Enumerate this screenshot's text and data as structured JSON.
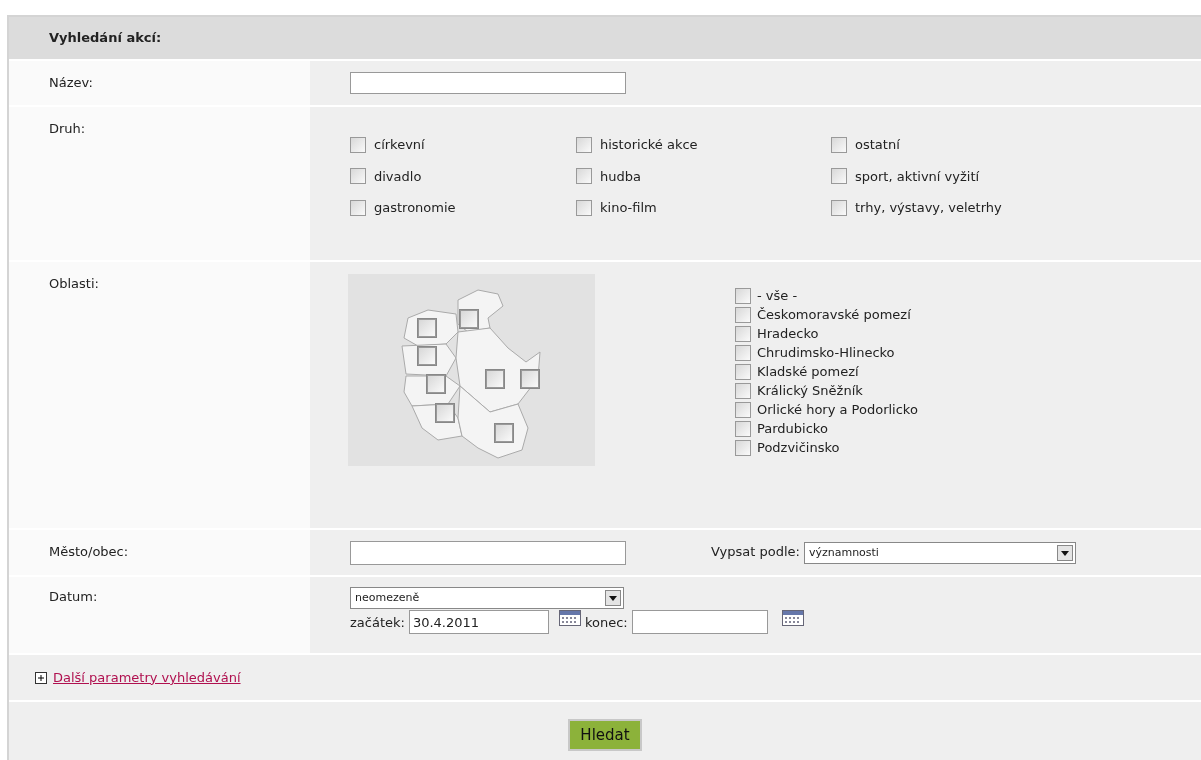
{
  "header": "Vyhledání akcí:",
  "name_field": {
    "label": "Název:"
  },
  "types": {
    "label": "Druh:",
    "options": [
      {
        "label": "církevní",
        "checked": false
      },
      {
        "label": "historické akce",
        "checked": false
      },
      {
        "label": "ostatní",
        "checked": false
      },
      {
        "label": "divadlo",
        "checked": false
      },
      {
        "label": "hudba",
        "checked": false
      },
      {
        "label": "sport, aktivní vyžití",
        "checked": false
      },
      {
        "label": "gastronomie",
        "checked": false
      },
      {
        "label": "kino-film",
        "checked": false
      },
      {
        "label": "trhy, výstavy, veletrhy",
        "checked": false
      }
    ]
  },
  "regions": {
    "label": "Oblasti:",
    "map_checkboxes": [
      {
        "checked": false
      },
      {
        "checked": false
      },
      {
        "checked": false
      },
      {
        "checked": false
      },
      {
        "checked": false
      },
      {
        "checked": false
      },
      {
        "checked": false
      },
      {
        "checked": false
      }
    ],
    "options": [
      {
        "label": "- vše -",
        "checked": false
      },
      {
        "label": "Českomoravské pomezí",
        "checked": false
      },
      {
        "label": "Hradecko",
        "checked": false
      },
      {
        "label": "Chrudimsko-Hlinecko",
        "checked": false
      },
      {
        "label": "Kladské pomezí",
        "checked": false
      },
      {
        "label": "Králický Sněžník",
        "checked": false
      },
      {
        "label": "Orlické hory a Podorlicko",
        "checked": false
      },
      {
        "label": "Pardubicko",
        "checked": false
      },
      {
        "label": "Podzvičinsko",
        "checked": false
      }
    ]
  },
  "city": {
    "label": "Město/obec:"
  },
  "sort": {
    "label": "Vypsat podle:",
    "value": "významnosti"
  },
  "date": {
    "label": "Datum:",
    "range": "neomezeně",
    "start_label": "začátek:",
    "start": "30.4.2011",
    "end_label": "konec:"
  },
  "more_link": {
    "label": "Další parametry vyhledávání",
    "expanded": false
  },
  "search_button": "Hledat"
}
